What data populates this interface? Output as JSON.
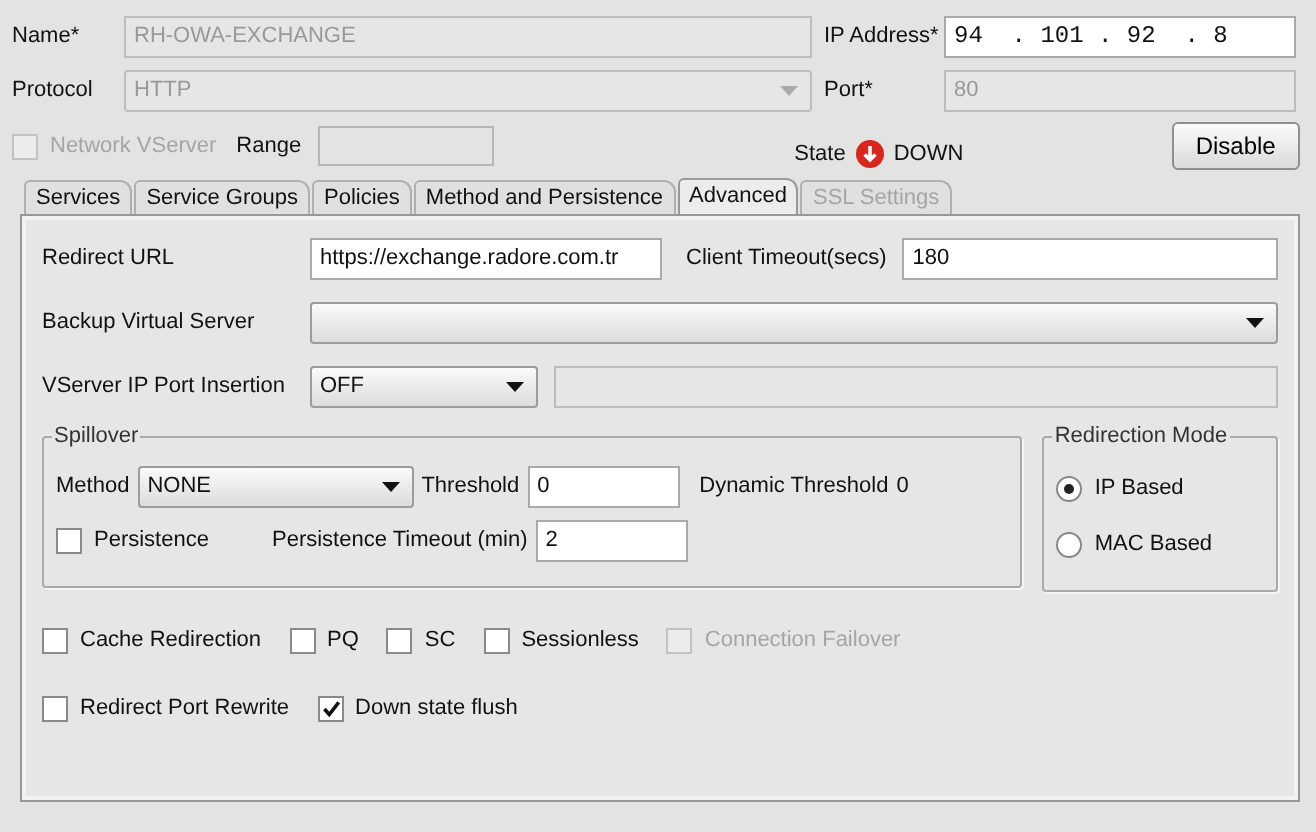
{
  "form": {
    "name": {
      "label": "Name*",
      "value": "RH-OWA-EXCHANGE",
      "disabled": true
    },
    "ip_address": {
      "label": "IP Address*",
      "value": "94  . 101 . 92  . 8"
    },
    "protocol": {
      "label": "Protocol",
      "value": "HTTP",
      "disabled": true
    },
    "port": {
      "label": "Port*",
      "value": "80",
      "disabled": true
    },
    "network_vserver": {
      "label": "Network VServer",
      "checked": false,
      "disabled": true
    },
    "range": {
      "label": "Range"
    },
    "state": {
      "label": "State",
      "value": "DOWN"
    },
    "disable_button": "Disable"
  },
  "tabs": [
    {
      "label": "Services",
      "selected": false,
      "disabled": false
    },
    {
      "label": "Service Groups",
      "selected": false,
      "disabled": false
    },
    {
      "label": "Policies",
      "selected": false,
      "disabled": false
    },
    {
      "label": "Method and Persistence",
      "selected": false,
      "disabled": false
    },
    {
      "label": "Advanced",
      "selected": true,
      "disabled": false
    },
    {
      "label": "SSL Settings",
      "selected": false,
      "disabled": true
    }
  ],
  "advanced": {
    "redirect_url": {
      "label": "Redirect URL",
      "value": "https://exchange.radore.com.tr"
    },
    "client_timeout": {
      "label": "Client Timeout(secs)",
      "value": "180"
    },
    "backup_virtual_server": {
      "label": "Backup Virtual Server"
    },
    "vserver_ip_port_insertion": {
      "label": "VServer IP Port Insertion",
      "value": "OFF"
    },
    "spillover": {
      "title": "Spillover",
      "method": {
        "label": "Method",
        "value": "NONE"
      },
      "threshold": {
        "label": "Threshold",
        "value": "0"
      },
      "dynamic_threshold": {
        "label": "Dynamic Threshold",
        "value": "0"
      },
      "persistence": {
        "label": "Persistence",
        "checked": false
      },
      "persistence_timeout": {
        "label": "Persistence Timeout (min)",
        "value": "2"
      }
    },
    "redirection_mode": {
      "title": "Redirection Mode",
      "options": [
        {
          "label": "IP Based",
          "selected": true
        },
        {
          "label": "MAC Based",
          "selected": false
        }
      ]
    },
    "option_rows": [
      [
        {
          "label": "Cache Redirection",
          "checked": false,
          "disabled": false
        },
        {
          "label": "PQ",
          "checked": false,
          "disabled": false
        },
        {
          "label": "SC",
          "checked": false,
          "disabled": false
        },
        {
          "label": "Sessionless",
          "checked": false,
          "disabled": false
        },
        {
          "label": "Connection Failover",
          "checked": false,
          "disabled": true
        }
      ],
      [
        {
          "label": "Redirect Port Rewrite",
          "checked": false,
          "disabled": false
        },
        {
          "label": "Down state flush",
          "checked": true,
          "disabled": false
        }
      ]
    ]
  }
}
